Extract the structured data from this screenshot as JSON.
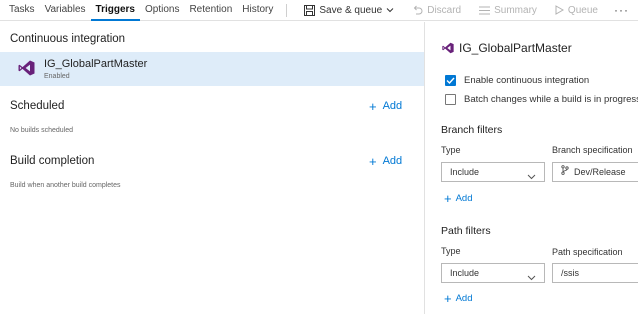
{
  "tabs": [
    {
      "label": "Tasks",
      "active": false
    },
    {
      "label": "Variables",
      "active": false
    },
    {
      "label": "Triggers",
      "active": true
    },
    {
      "label": "Options",
      "active": false
    },
    {
      "label": "Retention",
      "active": false
    },
    {
      "label": "History",
      "active": false
    }
  ],
  "toolbar": {
    "save_queue": "Save & queue",
    "discard": "Discard",
    "summary": "Summary",
    "queue": "Queue",
    "more": "···"
  },
  "left": {
    "ci": {
      "heading": "Continuous integration",
      "item_name": "IG_GlobalPartMaster",
      "item_status": "Enabled"
    },
    "scheduled": {
      "heading": "Scheduled",
      "add_label": "Add",
      "empty": "No builds scheduled"
    },
    "completion": {
      "heading": "Build completion",
      "add_label": "Add",
      "empty": "Build when another build completes"
    }
  },
  "right": {
    "title": "IG_GlobalPartMaster",
    "enable_ci": {
      "label": "Enable continuous integration",
      "checked": true
    },
    "batch": {
      "label": "Batch changes while a build is in progress",
      "checked": false
    },
    "branch_filters": {
      "heading": "Branch filters",
      "type_label": "Type",
      "spec_label": "Branch specification",
      "type_value": "Include",
      "spec_value": "Dev/Release",
      "add_label": "Add"
    },
    "path_filters": {
      "heading": "Path filters",
      "type_label": "Type",
      "spec_label": "Path specification",
      "type_value": "Include",
      "spec_value": "/ssis",
      "add_label": "Add"
    }
  },
  "colors": {
    "accent": "#0078d4",
    "selected_row": "#deecf9",
    "vs_logo": "#68217a"
  }
}
